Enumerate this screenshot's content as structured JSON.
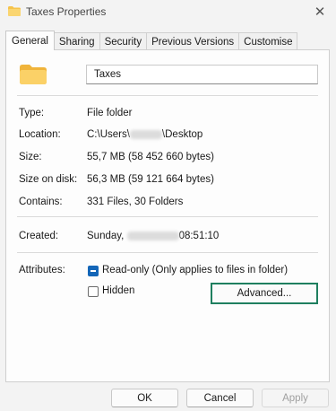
{
  "window": {
    "title": "Taxes Properties",
    "close_glyph": "✕"
  },
  "tabs": [
    {
      "label": "General",
      "active": true
    },
    {
      "label": "Sharing",
      "active": false
    },
    {
      "label": "Security",
      "active": false
    },
    {
      "label": "Previous Versions",
      "active": false
    },
    {
      "label": "Customise",
      "active": false
    }
  ],
  "general": {
    "folder_name": "Taxes",
    "type_label": "Type:",
    "type_value": "File folder",
    "location_label": "Location:",
    "location_prefix": "C:\\Users\\",
    "location_suffix": "\\Desktop",
    "size_label": "Size:",
    "size_value": "55,7 MB (58 452 660 bytes)",
    "size_on_disk_label": "Size on disk:",
    "size_on_disk_value": "56,3 MB (59 121 664 bytes)",
    "contains_label": "Contains:",
    "contains_value": "331 Files, 30 Folders",
    "created_label": "Created:",
    "created_prefix": "Sunday,",
    "created_suffix": "08:51:10",
    "attributes_label": "Attributes:",
    "readonly_label": "Read-only (Only applies to files in folder)",
    "readonly_state": "indeterminate",
    "hidden_label": "Hidden",
    "hidden_checked": false,
    "advanced_label": "Advanced..."
  },
  "buttons": {
    "ok": "OK",
    "cancel": "Cancel",
    "apply": "Apply"
  },
  "colors": {
    "accent": "#1366b8",
    "focus_outline": "#1f7f5f",
    "folder": "#f6c34a"
  }
}
